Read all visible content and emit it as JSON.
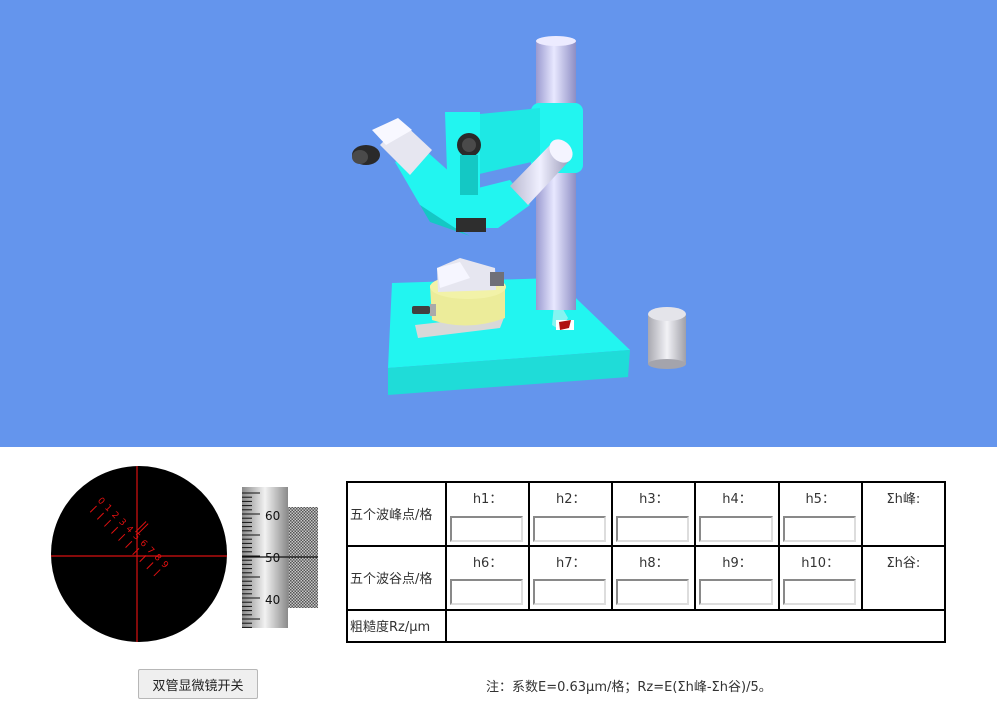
{
  "drum": {
    "ticks": [
      "60",
      "50",
      "40"
    ]
  },
  "eyepiece": {
    "scale_labels": [
      "0",
      "1",
      "2",
      "3",
      "4",
      "5",
      "6",
      "7",
      "8",
      "9"
    ]
  },
  "table": {
    "peak_row_label": "五个波峰点/格",
    "valley_row_label": "五个波谷点/格",
    "rz_row_label": "粗糙度Rz/μm",
    "peak_headers": [
      "h1：",
      "h2：",
      "h3：",
      "h4：",
      "h5："
    ],
    "peak_sum_label": "Σh峰:",
    "valley_headers": [
      "h6：",
      "h7：",
      "h8：",
      "h9：",
      "h10："
    ],
    "valley_sum_label": "Σh谷:",
    "peak_values": [
      "",
      "",
      "",
      "",
      ""
    ],
    "valley_values": [
      "",
      "",
      "",
      "",
      ""
    ],
    "rz_value": ""
  },
  "button": {
    "label": "双管显微镜开关"
  },
  "note": "注：系数E=0.63μm/格；Rz=E(Σh峰-Σh谷)/5。",
  "colors": {
    "scene_bg": "#6495ED",
    "device_cyan": "#22F5F0",
    "reticle_red": "#E01010"
  }
}
